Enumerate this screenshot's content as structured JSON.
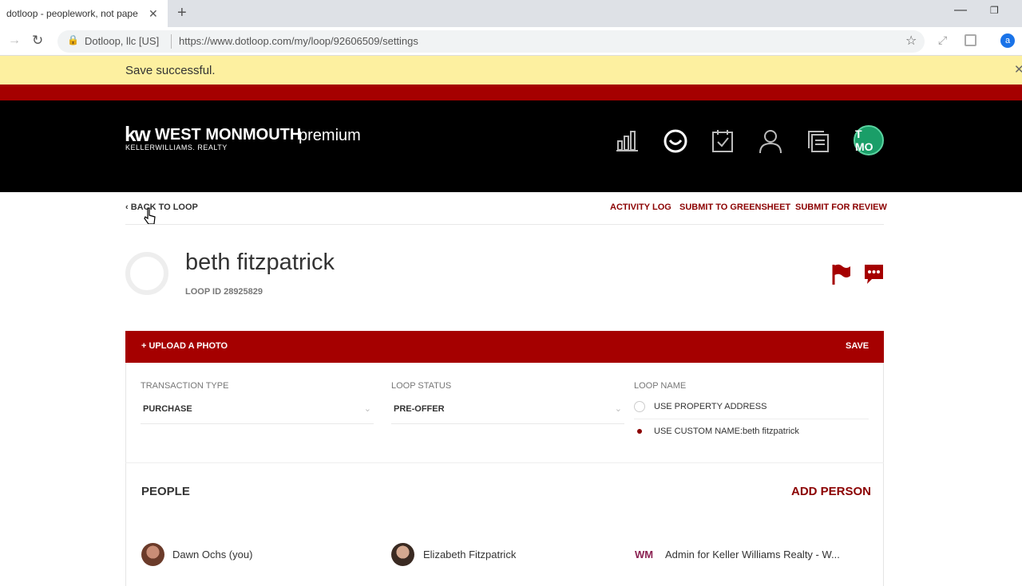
{
  "browser": {
    "tab_title": "dotloop - peoplework, not pape",
    "site_identity": "Dotloop, llc [US]",
    "url": "https://www.dotloop.com/my/loop/92606509/settings",
    "profile_initial": "a"
  },
  "notice": {
    "message": "Save successful."
  },
  "header": {
    "logo_kw": "kw",
    "logo_office": "WEST MONMOUTH",
    "logo_brand": "KELLERWILLIAMS. REALTY",
    "tier": "premium",
    "avatar_initials": "T MO",
    "icons": [
      "bar-chart-icon",
      "smiley-icon",
      "checklist-icon",
      "person-icon",
      "documents-icon"
    ]
  },
  "subnav": {
    "back": "BACK TO LOOP",
    "links": [
      "ACTIVITY LOG",
      "SUBMIT TO GREENSHEET",
      "SUBMIT FOR REVIEW"
    ]
  },
  "loop": {
    "title": "beth fitzpatrick",
    "id_label": "LOOP ID 28925829"
  },
  "actions": {
    "upload": "UPLOAD A PHOTO",
    "save": "SAVE"
  },
  "form": {
    "transaction_type": {
      "label": "TRANSACTION TYPE",
      "value": "PURCHASE"
    },
    "loop_status": {
      "label": "LOOP STATUS",
      "value": "PRE-OFFER"
    },
    "loop_name": {
      "label": "LOOP NAME",
      "option_address": "USE PROPERTY ADDRESS",
      "option_custom": "USE CUSTOM NAME:",
      "custom_value": "beth fitzpatrick",
      "selected": "custom"
    }
  },
  "people": {
    "title": "PEOPLE",
    "add": "ADD PERSON",
    "list": [
      {
        "name": "Dawn Ochs (you)"
      },
      {
        "name": "Elizabeth Fitzpatrick"
      },
      {
        "badge": "WM",
        "name": "Admin for Keller Williams Realty - W..."
      }
    ]
  },
  "colors": {
    "brand_red": "#a50000",
    "link_red": "#8b0000",
    "header_bg": "#000000",
    "notice_bg": "#fdf0a0"
  }
}
